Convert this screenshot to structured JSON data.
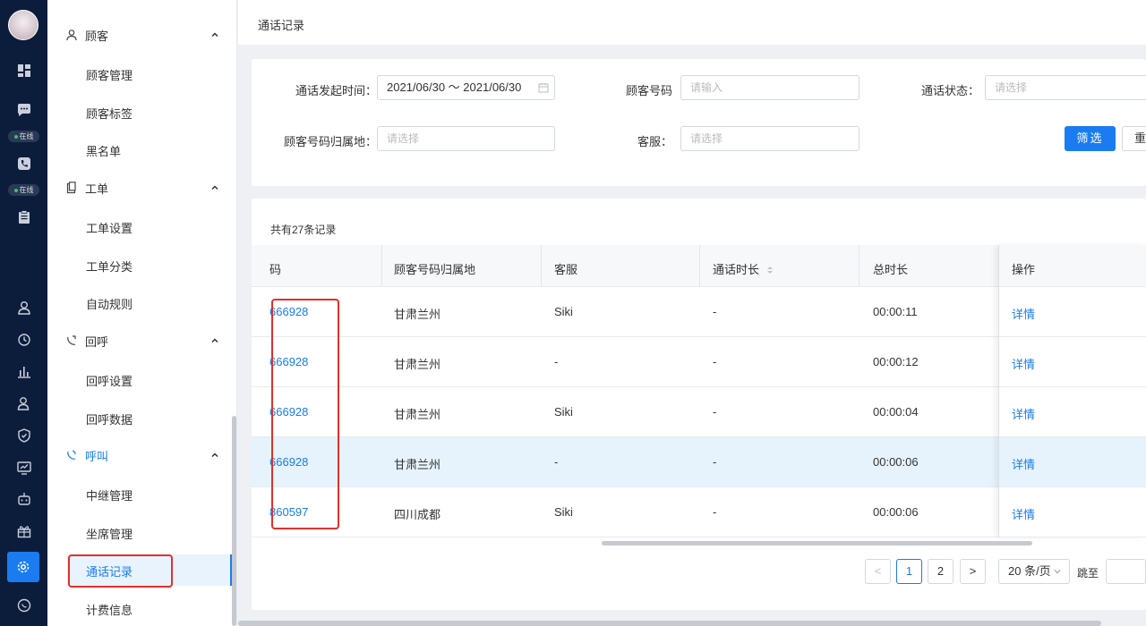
{
  "rail": {
    "badges": [
      "在线",
      "在线"
    ]
  },
  "sidebar": {
    "groups": [
      {
        "label": "顾客",
        "icon": "user-icon",
        "items": [
          "顾客管理",
          "顾客标签",
          "黑名单"
        ]
      },
      {
        "label": "工单",
        "icon": "clipboard-icon",
        "items": [
          "工单设置",
          "工单分类",
          "自动规则"
        ]
      },
      {
        "label": "回呼",
        "icon": "callback-icon",
        "items": [
          "回呼设置",
          "回呼数据"
        ]
      },
      {
        "label": "呼叫",
        "icon": "call-icon",
        "items": [
          "中继管理",
          "坐席管理",
          "通话记录",
          "计费信息"
        ]
      }
    ],
    "selected": "通话记录"
  },
  "page": {
    "title": "通话记录"
  },
  "filters": {
    "time_label": "通话发起时间：",
    "time_value": "2021/06/30 ～ 2021/06/30",
    "phone_label": "顾客号码",
    "phone_placeholder": "请输入",
    "status_label": "通话状态：",
    "status_placeholder": "请选择",
    "region_label": "顾客号码归属地：",
    "region_placeholder": "请选择",
    "agent_label": "客服：",
    "agent_placeholder": "请选择",
    "filter_button": "筛选",
    "reset_button": "重"
  },
  "table": {
    "count_text": "共有27条记录",
    "headers": [
      "码",
      "顾客号码归属地",
      "客服",
      "通话时长",
      "总时长",
      "操作"
    ],
    "rows": [
      {
        "number": "666928",
        "region": "甘肃兰州",
        "agent": "Siki",
        "duration": "-",
        "total": "00:00:11",
        "action": "详情"
      },
      {
        "number": "666928",
        "region": "甘肃兰州",
        "agent": "-",
        "duration": "-",
        "total": "00:00:12",
        "action": "详情"
      },
      {
        "number": "666928",
        "region": "甘肃兰州",
        "agent": "Siki",
        "duration": "-",
        "total": "00:00:04",
        "action": "详情"
      },
      {
        "number": "666928",
        "region": "甘肃兰州",
        "agent": "-",
        "duration": "-",
        "total": "00:00:06",
        "action": "详情"
      },
      {
        "number": "860597",
        "region": "四川成都",
        "agent": "Siki",
        "duration": "-",
        "total": "00:00:06",
        "action": "详情"
      }
    ]
  },
  "pagination": {
    "prev": "<",
    "pages": [
      "1",
      "2"
    ],
    "current": "1",
    "next": ">",
    "page_size": "20 条/页",
    "jump_label": "跳至"
  },
  "colors": {
    "primary": "#1a7cf0",
    "rail": "#0c1d3c",
    "highlight_row": "#e6f3fc",
    "annotation": "#e2302c"
  }
}
